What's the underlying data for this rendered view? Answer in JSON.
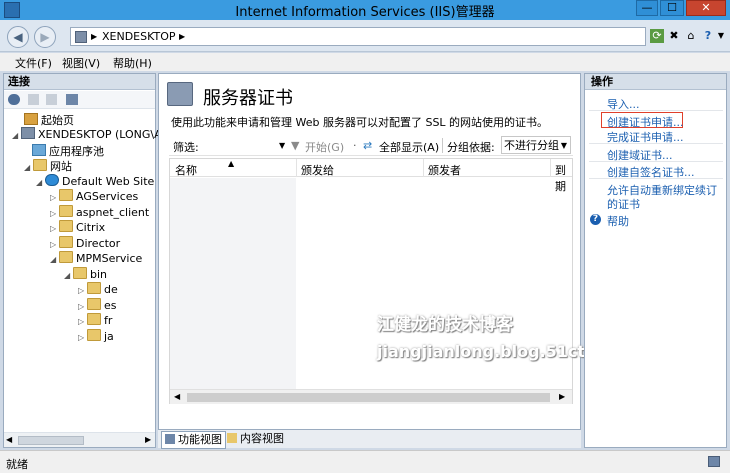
{
  "window": {
    "title": "Internet Information Services (IIS)管理器"
  },
  "address": {
    "path": "XENDESKTOP"
  },
  "menu": {
    "file": "文件(F)",
    "view": "视图(V)",
    "help": "帮助(H)"
  },
  "connections": {
    "header": "连接",
    "tree": {
      "start_page": "起始页",
      "server": "XENDESKTOP (LONG\\A",
      "app_pools": "应用程序池",
      "sites": "网站",
      "default_site": "Default Web Site",
      "children": [
        "AGServices",
        "aspnet_client",
        "Citrix",
        "Director",
        "MPMService"
      ],
      "bin": "bin",
      "bin_children": [
        "de",
        "es",
        "fr",
        "ja"
      ]
    }
  },
  "main": {
    "title": "服务器证书",
    "description": "使用此功能来申请和管理 Web 服务器可以对配置了 SSL 的网站使用的证书。",
    "filter_label": "筛选:",
    "go_label": "开始(G)",
    "show_all_label": "全部显示(A)",
    "group_by_label": "分组依据:",
    "group_by_value": "不进行分组",
    "columns": [
      "名称",
      "颁发给",
      "颁发者",
      "到期"
    ],
    "watermark_name": "江健龙的技术博客",
    "watermark_url": "jiangjianlong.blog.51cto.com",
    "tabs": {
      "feature_view": "功能视图",
      "content_view": "内容视图"
    }
  },
  "actions": {
    "header": "操作",
    "import": "导入...",
    "create_request": "创建证书申请...",
    "complete_request": "完成证书申请...",
    "create_domain_cert": "创建域证书...",
    "create_self_signed": "创建自签名证书...",
    "auto_rebind_1": "允许自动重新绑定续订",
    "auto_rebind_2": "的证书",
    "help": "帮助"
  },
  "status": {
    "text": "就绪"
  }
}
